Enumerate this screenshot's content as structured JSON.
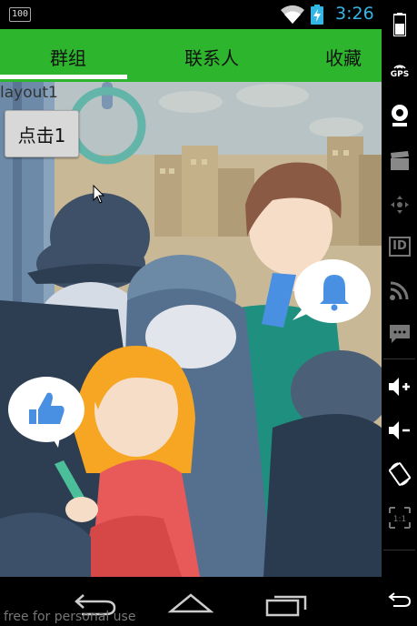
{
  "status_bar": {
    "battery_level": "100",
    "time": "3:26"
  },
  "tabs": [
    {
      "label": "群组",
      "selected": true
    },
    {
      "label": "联系人",
      "selected": false
    },
    {
      "label": "收藏",
      "selected": false
    }
  ],
  "content": {
    "layout_label": "layout1",
    "button_label": "点击1"
  },
  "side_bar": {
    "icons": [
      "battery-icon",
      "gps-icon",
      "webcam-icon",
      "media-icon",
      "dpad-icon",
      "id-icon",
      "rss-icon",
      "sms-icon",
      "volume-up-icon",
      "volume-down-icon",
      "rotate-icon",
      "scale-icon",
      "back-icon"
    ],
    "gps_label": "GPS",
    "id_label": "ID",
    "scale_label": "1:1"
  },
  "nav_bar": {
    "buttons": [
      "back-button",
      "home-button",
      "recents-button"
    ]
  },
  "watermark": "free for personal use",
  "colors": {
    "tab_bar": "#2db52d",
    "tab_indicator": "#ffffff",
    "clock": "#33b5e5"
  }
}
